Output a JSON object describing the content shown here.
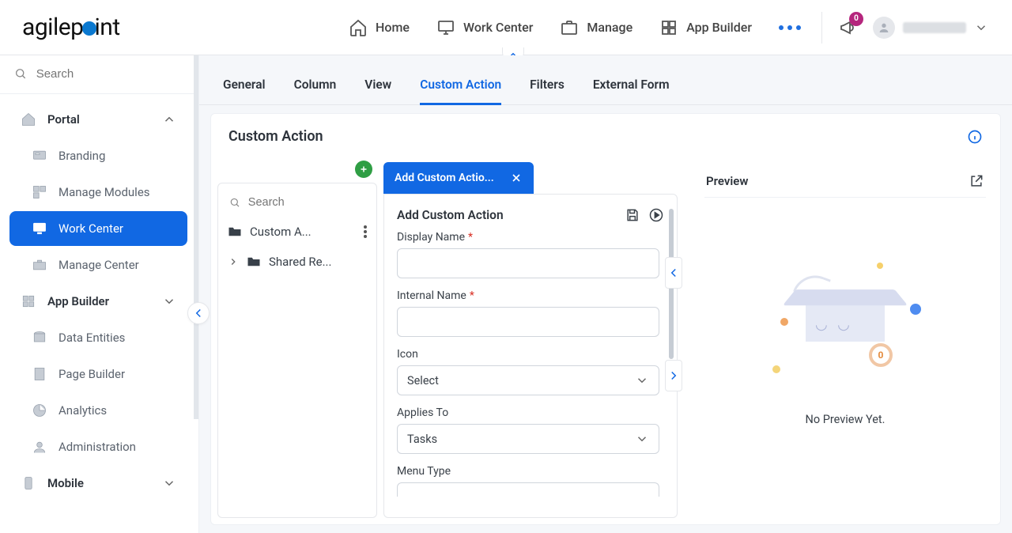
{
  "header": {
    "logo_a": "agilep",
    "logo_c": "int",
    "nav": {
      "home": "Home",
      "work_center": "Work Center",
      "manage": "Manage",
      "app_builder": "App Builder"
    },
    "notif_count": "0"
  },
  "sidebar": {
    "search_placeholder": "Search",
    "portal": {
      "label": "Portal"
    },
    "branding": {
      "label": "Branding"
    },
    "manage_modules": {
      "label": "Manage Modules"
    },
    "work_center": {
      "label": "Work Center"
    },
    "manage_center": {
      "label": "Manage Center"
    },
    "app_builder": {
      "label": "App Builder"
    },
    "data_entities": {
      "label": "Data Entities"
    },
    "page_builder": {
      "label": "Page Builder"
    },
    "analytics": {
      "label": "Analytics"
    },
    "administration": {
      "label": "Administration"
    },
    "mobile": {
      "label": "Mobile"
    }
  },
  "tabs": {
    "general": "General",
    "column": "Column",
    "view": "View",
    "custom_action": "Custom Action",
    "filters": "Filters",
    "external_form": "External Form"
  },
  "section": {
    "title": "Custom Action"
  },
  "tree": {
    "search_placeholder": "Search",
    "node_custom": "Custom A...",
    "node_shared": "Shared Re..."
  },
  "form": {
    "tab_label": "Add Custom Actio...",
    "title": "Add Custom Action",
    "display_name": {
      "label": "Display Name",
      "value": ""
    },
    "internal_name": {
      "label": "Internal Name",
      "value": ""
    },
    "icon": {
      "label": "Icon",
      "value": "Select"
    },
    "applies_to": {
      "label": "Applies To",
      "value": "Tasks"
    },
    "menu_type": {
      "label": "Menu Type"
    }
  },
  "preview": {
    "title": "Preview",
    "empty_text": "No Preview Yet.",
    "ring_value": "0"
  }
}
